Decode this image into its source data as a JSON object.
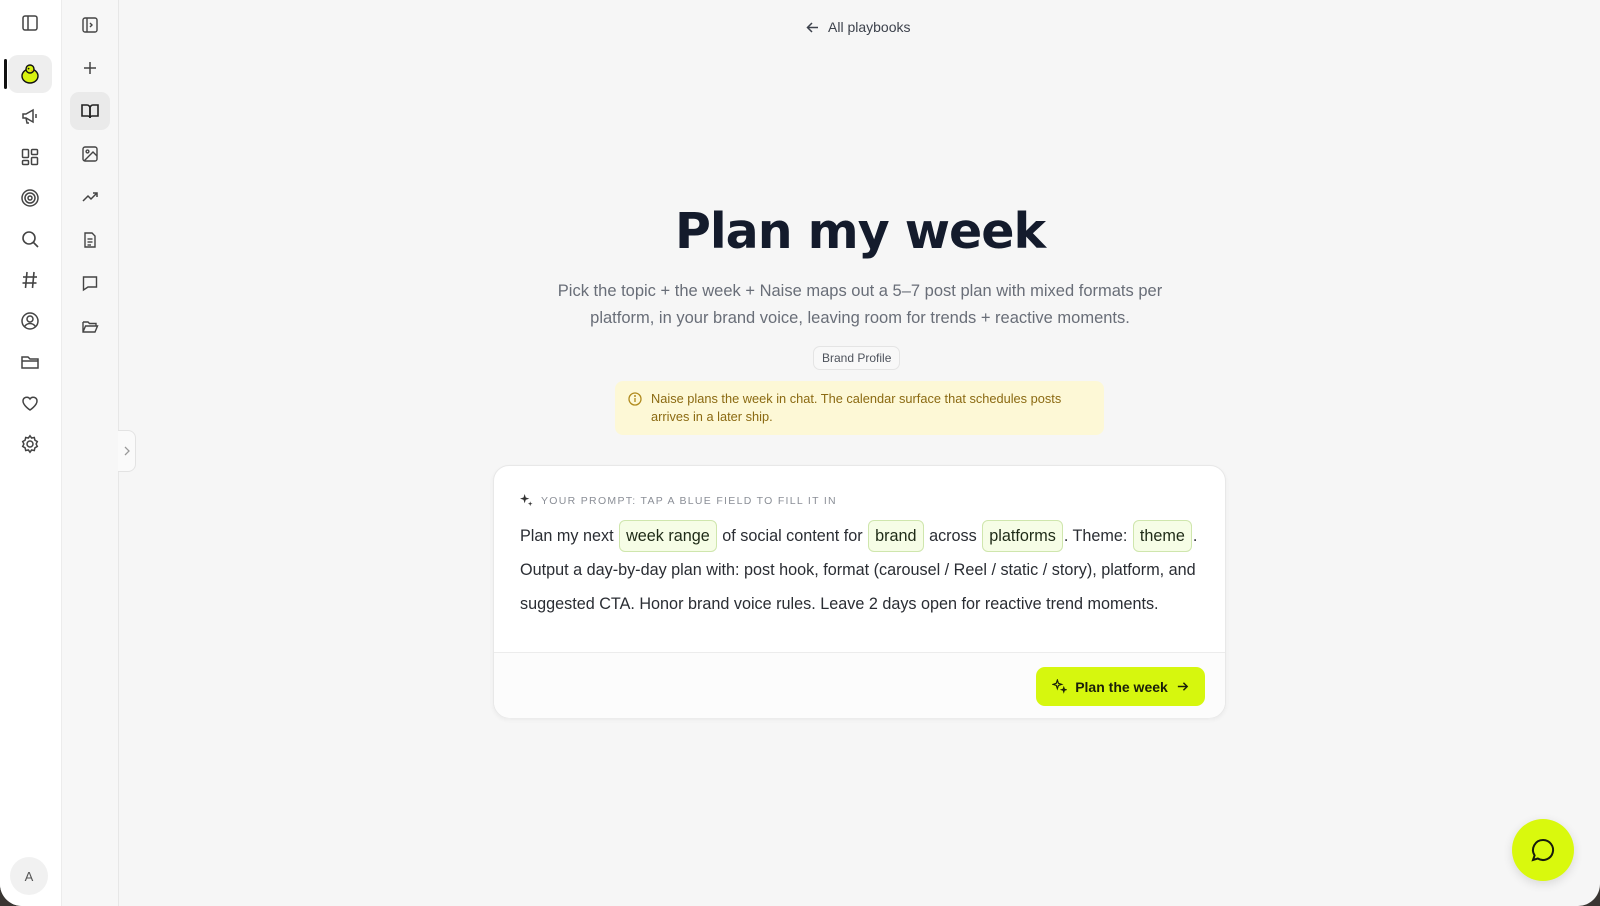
{
  "nav": {
    "back_label": "All playbooks",
    "avatar_initial": "A"
  },
  "icons": {
    "rail": [
      "sidebar-toggle-icon",
      "chick-logo-icon",
      "megaphone-icon",
      "grid-icon",
      "target-icon",
      "search-icon",
      "hashtag-icon",
      "user-circle-icon",
      "folder-icon",
      "heart-icon",
      "settings-icon"
    ],
    "rail2": [
      "panel-expand-icon",
      "plus-icon",
      "book-icon",
      "image-icon",
      "trending-icon",
      "document-icon",
      "message-icon",
      "folder-open-icon"
    ]
  },
  "page": {
    "title": "Plan my week",
    "subtitle": "Pick the topic + the week + Naise maps out a 5–7 post plan with mixed formats per platform, in your brand voice, leaving room for trends + reactive moments.",
    "chip": "Brand Profile",
    "notice": "Naise plans the week in chat. The calendar surface that schedules posts arrives in a later ship."
  },
  "prompt": {
    "label": "YOUR PROMPT: TAP A BLUE FIELD TO FILL IT IN",
    "t1": "Plan my next",
    "f1": "week range",
    "t2": "of social content for",
    "f2": "brand",
    "t3": "across",
    "f3": "platforms",
    "t4": ". Theme:",
    "f4": "theme",
    "t5": ". Output a day-by-day plan with: post hook, format (carousel / Reel / static / story), platform, and suggested CTA. Honor brand voice rules. Leave 2 days open for reactive trend moments.",
    "button": "Plan the week"
  },
  "colors": {
    "accent": "#d6f70e",
    "notice_bg": "#fdf8d6",
    "field_bg": "#f6fde6"
  }
}
